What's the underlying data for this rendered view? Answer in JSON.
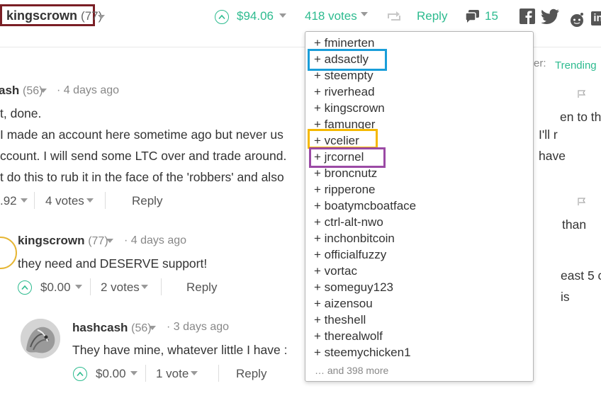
{
  "post": {
    "author": "kingscrown",
    "author_rep": "(77)",
    "payout": "$94.06",
    "votes": "418 votes",
    "reply": "Reply",
    "comment_count": "15"
  },
  "sidebar": {
    "sort_label": "er:",
    "sort_value": "Trending"
  },
  "comments": [
    {
      "author": "ash",
      "rep": "(56)",
      "age": "4 days ago",
      "lines": [
        "t, done.",
        "I made an account here sometime ago but never us",
        "ccount. I will send some LTC over and trade around.",
        "t do this to rub it in the face of the 'robbers' and also"
      ],
      "payout": ".92",
      "votes": "4 votes",
      "reply": "Reply"
    },
    {
      "author": "kingscrown",
      "rep": "(77)",
      "age": "4 days ago",
      "body": "they need and DESERVE support!",
      "payout": "$0.00",
      "votes": "2 votes",
      "reply": "Reply"
    },
    {
      "author": "hashcash",
      "rep": "(56)",
      "age": "3 days ago",
      "body": "They have mine, whatever little I have :",
      "payout": "$0.00",
      "votes": "1 vote",
      "reply": "Reply"
    }
  ],
  "right_fragments": [
    "I'll r",
    "have",
    "en to th",
    "than",
    "east 5 c",
    "is"
  ],
  "voters": {
    "list": [
      "+ fminerten",
      "+ adsactly",
      "+ steempty",
      "+ riverhead",
      "+ kingscrown",
      "+ famunger",
      "+ vcelier",
      "+ jrcornel",
      "+ broncnutz",
      "+ ripperone",
      "+ boatymcboatface",
      "+ ctrl-alt-nwo",
      "+ inchonbitcoin",
      "+ officialfuzzy",
      "+ vortac",
      "+ someguy123",
      "+ aizensou",
      "+ theshell",
      "+ therealwolf",
      "+ steemychicken1"
    ],
    "more": "… and 398 more",
    "highlight_colors": {
      "adsactly": "#1a9ed9",
      "vcelier": "#f5b800",
      "jrcornel": "#9b4aa5"
    }
  },
  "colors": {
    "accent": "#2dbb8f",
    "author_box": "#7a1f25"
  },
  "icons": [
    "upvote-icon",
    "chevron-down-icon",
    "resteem-icon",
    "comments-icon",
    "facebook-icon",
    "twitter-icon",
    "reddit-icon",
    "linkedin-icon",
    "flag-icon"
  ]
}
